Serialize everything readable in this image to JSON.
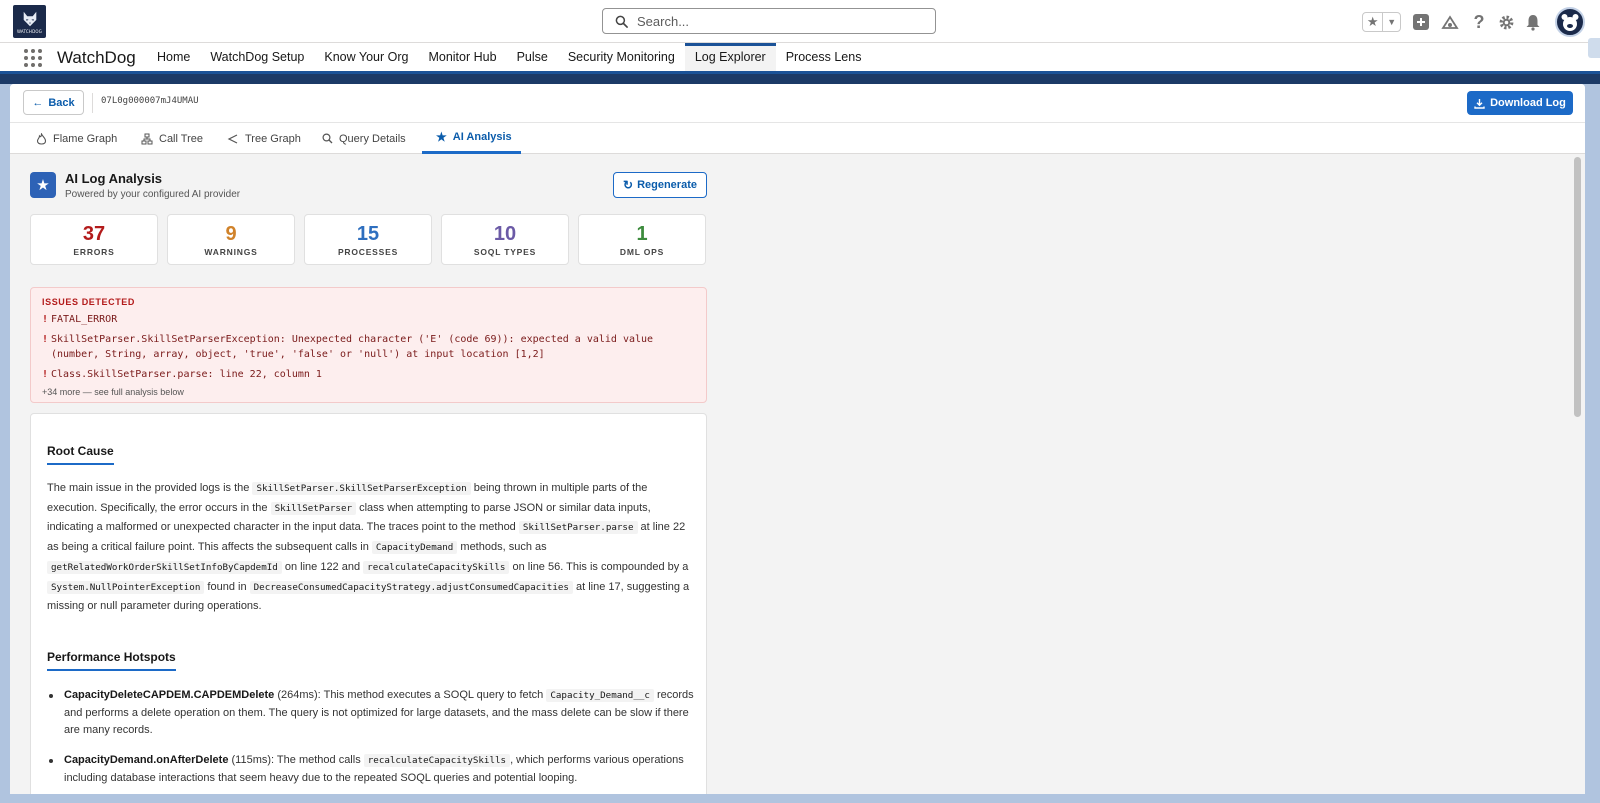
{
  "global": {
    "logo_text": "WATCHDOG",
    "search_placeholder": "Search..."
  },
  "app": {
    "name": "WatchDog",
    "nav": [
      "Home",
      "WatchDog Setup",
      "Know Your Org",
      "Monitor Hub",
      "Pulse",
      "Security Monitoring",
      "Log Explorer",
      "Process Lens"
    ],
    "active_nav": "Log Explorer"
  },
  "toolbar": {
    "back_label": "Back",
    "log_id": "07L0g000007mJ4UMAU",
    "download_label": "Download Log"
  },
  "tabs": [
    {
      "label": "Flame Graph",
      "icon": "flame-icon"
    },
    {
      "label": "Call Tree",
      "icon": "hierarchy-icon"
    },
    {
      "label": "Tree Graph",
      "icon": "share-icon"
    },
    {
      "label": "Query Details",
      "icon": "search-icon"
    },
    {
      "label": "AI Analysis",
      "icon": "star-icon",
      "active": true
    }
  ],
  "analysis": {
    "title": "AI Log Analysis",
    "subtitle": "Powered by your configured AI provider",
    "regenerate_label": "Regenerate",
    "stats": [
      {
        "value": "37",
        "label": "ERRORS",
        "color": "#b31b1b"
      },
      {
        "value": "9",
        "label": "WARNINGS",
        "color": "#d0822a"
      },
      {
        "value": "15",
        "label": "PROCESSES",
        "color": "#2e6fbf"
      },
      {
        "value": "10",
        "label": "SOQL TYPES",
        "color": "#6b5aa6"
      },
      {
        "value": "1",
        "label": "DML OPS",
        "color": "#3d8b3d"
      }
    ],
    "issues": {
      "title": "ISSUES DETECTED",
      "items": [
        "FATAL_ERROR",
        "SkillSetParser.SkillSetParserException: Unexpected character ('E' (code 69)): expected a valid value (number, String, array, object, 'true', 'false' or 'null') at input location [1,2]",
        "Class.SkillSetParser.parse: line 22, column 1"
      ],
      "more": "+34 more — see full analysis below"
    },
    "root_cause": {
      "heading": "Root Cause",
      "t1": "The main issue in the provided logs is the ",
      "c1": "SkillSetParser.SkillSetParserException",
      "t2": " being thrown in multiple parts of the execution. Specifically, the error occurs in the ",
      "c2": "SkillSetParser",
      "t3": " class when attempting to parse JSON or similar data inputs, indicating a malformed or unexpected character in the input data. The traces point to the method ",
      "c3": "SkillSetParser.parse",
      "t4": " at line 22 as being a critical failure point. This affects the subsequent calls in ",
      "c4": "CapacityDemand",
      "t5": " methods, such as ",
      "c5": "getRelatedWorkOrderSkillSetInfoByCapdemId",
      "t6": " on line 122 and ",
      "c6": "recalculateCapacitySkills",
      "t7": " on line 56. This is compounded by a ",
      "c7": "System.NullPointerException",
      "t8": " found in ",
      "c8": "DecreaseConsumedCapacityStrategy.adjustConsumedCapacities",
      "t9": " at line 17, suggesting a missing or null parameter during operations."
    },
    "hotspots": {
      "heading": "Performance Hotspots",
      "b1_name": "CapacityDeleteCAPDEM.CAPDEMDelete",
      "b1_t1": " (264ms): This method executes a SOQL query to fetch ",
      "b1_c1": "Capacity_Demand__c",
      "b1_t2": " records and performs a delete operation on them. The query is not optimized for large datasets, and the mass delete can be slow if there are many records.",
      "b2_name": "CapacityDemand.onAfterDelete",
      "b2_t1": " (115ms): The method calls ",
      "b2_c1": "recalculateCapacitySkills",
      "b2_t2": ", which performs various operations including database interactions that seem heavy due to the repeated SOQL queries and potential looping."
    }
  }
}
